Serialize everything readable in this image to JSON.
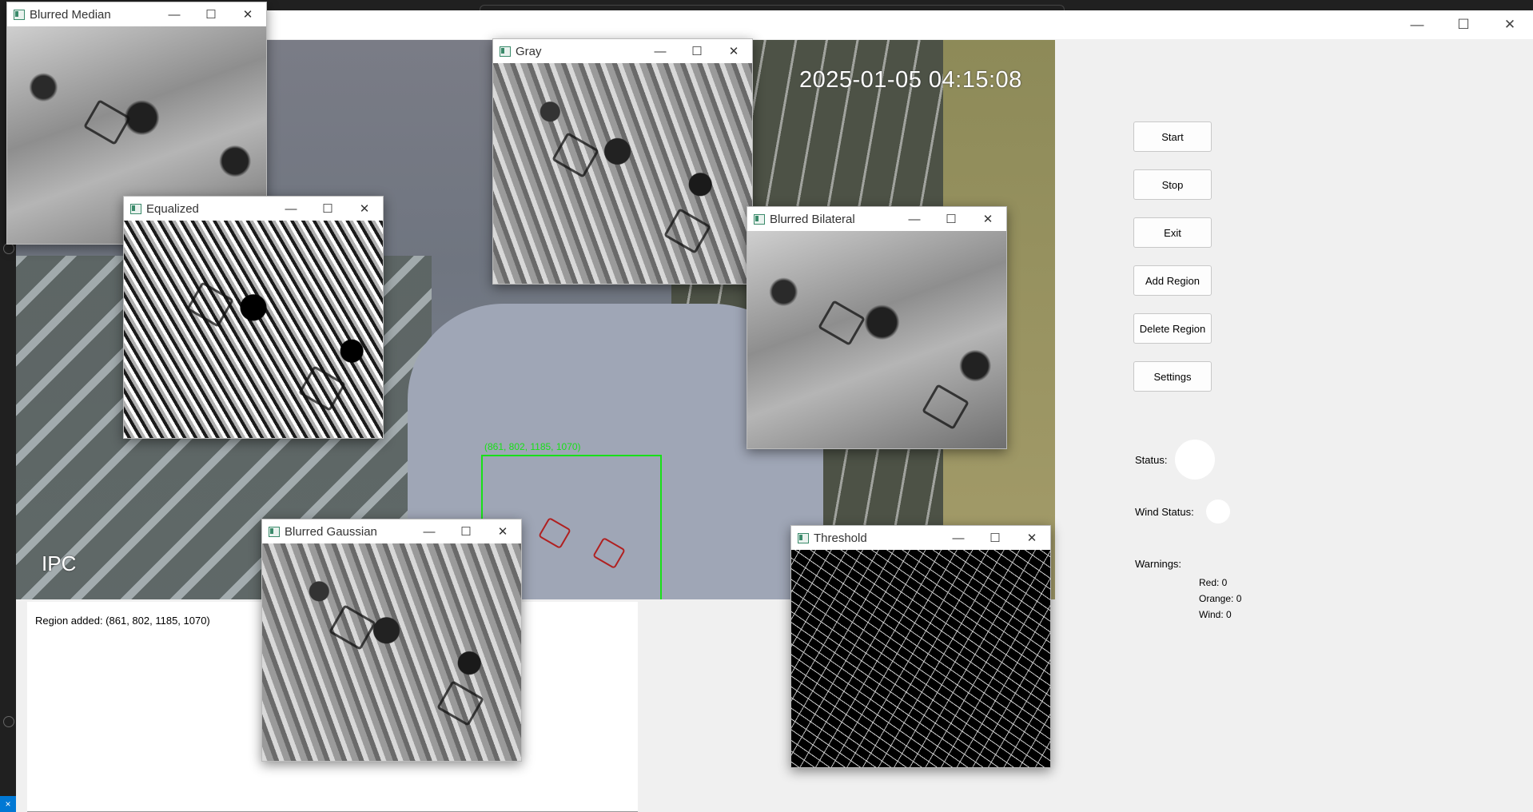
{
  "main_window": {
    "controls": {
      "minimize": "—",
      "maximize": "☐",
      "close": "✕"
    }
  },
  "feed": {
    "timestamp": "2025-01-05 04:15:08",
    "camera_label": "IPC",
    "roi_label": "(861, 802, 1185, 1070)"
  },
  "log": {
    "lines": [
      "Region added: (861, 802, 1185, 1070)"
    ]
  },
  "panel": {
    "buttons": {
      "start": "Start",
      "stop": "Stop",
      "exit": "Exit",
      "add_region": "Add Region",
      "delete_region": "Delete Region",
      "settings": "Settings"
    },
    "status_label": "Status:",
    "wind_status_label": "Wind Status:",
    "warnings_label": "Warnings:",
    "warnings": {
      "red": "Red: 0",
      "orange": "Orange: 0",
      "wind": "Wind: 0"
    }
  },
  "windows": {
    "blurred_median": "Blurred Median",
    "gray": "Gray",
    "equalized": "Equalized",
    "blurred_bilateral": "Blurred Bilateral",
    "blurred_gaussian": "Blurred Gaussian",
    "threshold": "Threshold"
  },
  "window_controls": {
    "minimize": "—",
    "maximize": "☐",
    "close": "✕"
  },
  "colors": {
    "roi_box": "#18e018",
    "status_indicator": "#ffffff",
    "window_background": "#f0f0f0"
  }
}
